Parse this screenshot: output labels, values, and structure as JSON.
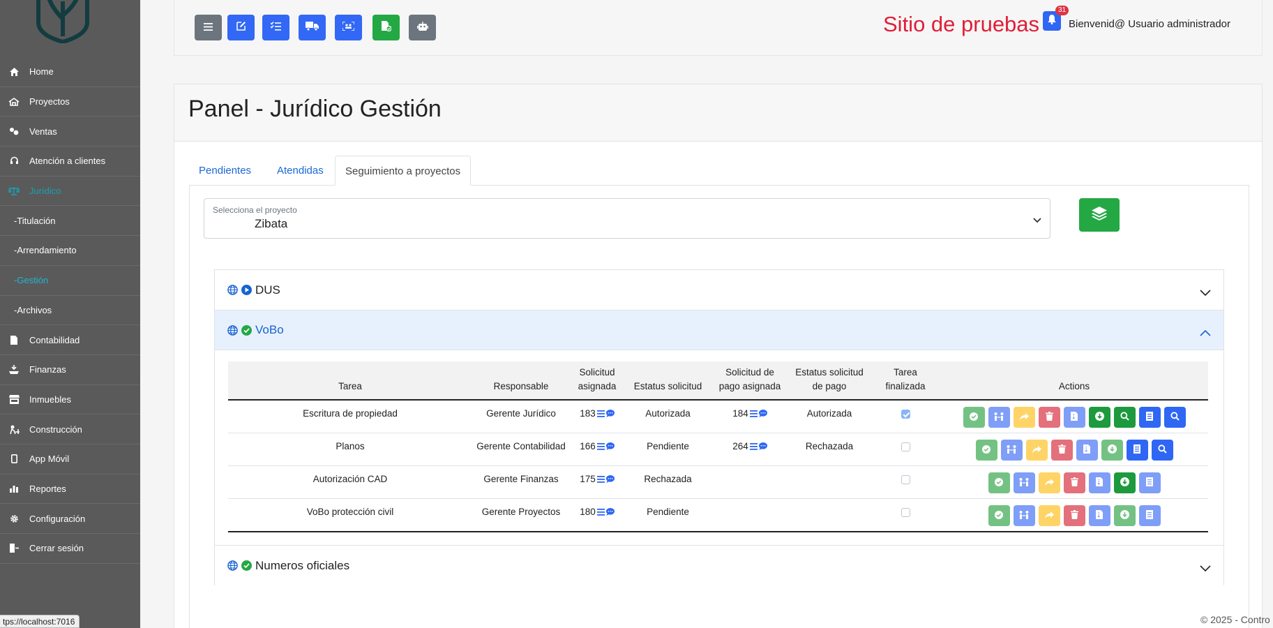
{
  "sidebar": {
    "items": [
      {
        "label": "Home",
        "icon": "home-icon"
      },
      {
        "label": "Proyectos",
        "icon": "project-icon"
      },
      {
        "label": "Ventas",
        "icon": "sales-icon"
      },
      {
        "label": "Atención a clientes",
        "icon": "headset-icon"
      },
      {
        "label": "Jurídico",
        "icon": "scale-icon"
      },
      {
        "label": "-Titulación"
      },
      {
        "label": "-Arrendamiento"
      },
      {
        "label": "-Gestión"
      },
      {
        "label": "-Archivos"
      },
      {
        "label": "Contabilidad",
        "icon": "file-icon"
      },
      {
        "label": "Finanzas",
        "icon": "finance-icon"
      },
      {
        "label": "Inmuebles",
        "icon": "store-icon"
      },
      {
        "label": "Construcción",
        "icon": "construction-icon"
      },
      {
        "label": "App Móvil",
        "icon": "mobile-icon"
      },
      {
        "label": "Reportes",
        "icon": "chart-icon"
      },
      {
        "label": "Configuración",
        "icon": "gear-icon"
      },
      {
        "label": "Cerrar sesión",
        "icon": "logout-icon"
      }
    ],
    "status_url": "tps://localhost:7016"
  },
  "header": {
    "site_title": "Sitio de pruebas",
    "notification_count": "31",
    "welcome": "Bienvenid@ Usuario administrador"
  },
  "panel": {
    "title": "Panel - Jurídico Gestión",
    "tabs": [
      "Pendientes",
      "Atendidas",
      "Seguimiento a proyectos"
    ],
    "select": {
      "label": "Selecciona el proyecto",
      "value": "Zibata"
    }
  },
  "accordion": {
    "sections": [
      "DUS",
      "VoBo",
      "Numeros oficiales"
    ]
  },
  "table": {
    "headers": [
      "Tarea",
      "Responsable",
      "Solicitud asignada",
      "Estatus solicitud",
      "Solicitud de pago asignada",
      "Estatus solicitud de pago",
      "Tarea finalizada",
      "Actions"
    ],
    "rows": [
      {
        "tarea": "Escritura de propiedad",
        "responsable": "Gerente Jurídico",
        "solicitud": "183",
        "estatus": "Autorizada",
        "pago": "184",
        "estatus_pago": "Autorizada",
        "finalizada": true
      },
      {
        "tarea": "Planos",
        "responsable": "Gerente Contabilidad",
        "solicitud": "166",
        "estatus": "Pendiente",
        "pago": "264",
        "estatus_pago": "Rechazada",
        "finalizada": false
      },
      {
        "tarea": "Autorización CAD",
        "responsable": "Gerente Finanzas",
        "solicitud": "175",
        "estatus": "Rechazada",
        "pago": "",
        "estatus_pago": "",
        "finalizada": false
      },
      {
        "tarea": "VoBo protección civil",
        "responsable": "Gerente Proyectos",
        "solicitud": "180",
        "estatus": "Pendiente",
        "pago": "",
        "estatus_pago": "",
        "finalizada": false
      }
    ]
  },
  "footer": {
    "text": "© 2025 - Contro"
  },
  "colors": {
    "accent": "#3268f5",
    "success": "#24a844",
    "danger": "#e01e37",
    "sidebar": "#5a5a5a",
    "active": "#1c9fb4"
  }
}
